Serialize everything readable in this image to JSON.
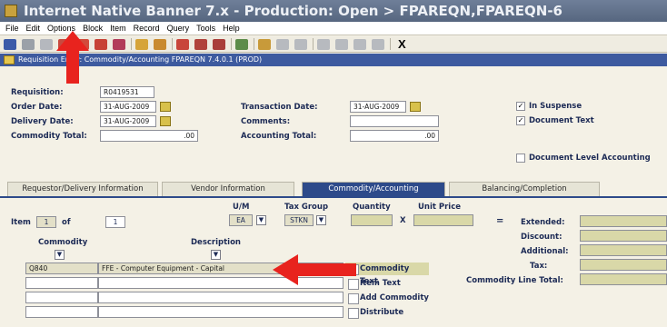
{
  "window": {
    "title": "Internet Native Banner 7.x - Production:  Open > FPAREQN,FPAREQN-6"
  },
  "menu": {
    "items": [
      "File",
      "Edit",
      "Options",
      "Block",
      "Item",
      "Record",
      "Query",
      "Tools",
      "Help"
    ]
  },
  "toolbar": {
    "close_glyph": "X"
  },
  "form": {
    "title": "Requisition Entry: Commodity/Accounting  FPAREQN  7.4.0.1  (PROD)"
  },
  "header": {
    "requisition_label": "Requisition:",
    "requisition_value": "R0419531",
    "order_date_label": "Order Date:",
    "order_date_value": "31-AUG-2009",
    "delivery_date_label": "Delivery Date:",
    "delivery_date_value": "31-AUG-2009",
    "commodity_total_label": "Commodity Total:",
    "commodity_total_value": ".00",
    "transaction_date_label": "Transaction Date:",
    "transaction_date_value": "31-AUG-2009",
    "comments_label": "Comments:",
    "accounting_total_label": "Accounting Total:",
    "accounting_total_value": ".00",
    "in_suspense_label": "In Suspense",
    "document_text_label": "Document Text",
    "document_level_accounting_label": "Document Level Accounting",
    "check_glyph": "✓"
  },
  "tabs": [
    {
      "label": "Requestor/Delivery Information"
    },
    {
      "label": "Vendor Information"
    },
    {
      "label": "Commodity/Accounting"
    },
    {
      "label": "Balancing/Completion"
    }
  ],
  "commodity": {
    "um_label": "U/M",
    "tax_group_label": "Tax Group",
    "quantity_label": "Quantity",
    "unit_price_label": "Unit Price",
    "item_label": "Item",
    "item_value": "1",
    "of_label": "of",
    "of_value": "1",
    "um_value": "EA",
    "tax_group_value": "STKN",
    "times_glyph": "X",
    "equals_glyph": "=",
    "extended_label": "Extended:",
    "discount_label": "Discount:",
    "additional_label": "Additional:",
    "tax_label": "Tax:",
    "line_total_label": "Commodity Line Total:",
    "commodity_col_label": "Commodity",
    "description_col_label": "Description",
    "rows": [
      {
        "code": "Q840",
        "description": "FFE - Computer Equipment - Capital"
      },
      {
        "code": "",
        "description": ""
      },
      {
        "code": "",
        "description": ""
      },
      {
        "code": "",
        "description": ""
      }
    ],
    "commodity_text_label": "Commodity Text",
    "item_text_label": "Item Text",
    "add_commodity_label": "Add Commodity",
    "distribute_label": "Distribute"
  },
  "colors": {
    "annotation_arrow": "#e8231e",
    "active_tab": "#2d4a8a",
    "form_bar": "#3d5a9f"
  }
}
